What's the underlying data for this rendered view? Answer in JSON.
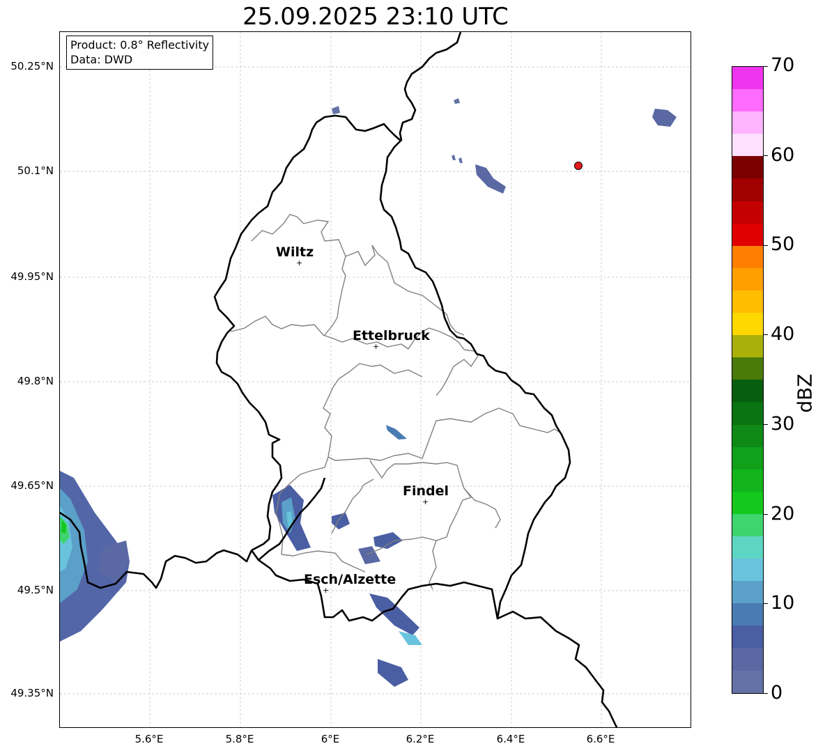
{
  "title": "25.09.2025 23:10 UTC",
  "info": {
    "product": "Product: 0.8° Reflectivity",
    "data": "Data: DWD"
  },
  "lat_ticks": [
    "50.25°N",
    "50.1°N",
    "49.95°N",
    "49.8°N",
    "49.65°N",
    "49.5°N",
    "49.35°N"
  ],
  "lon_ticks": [
    "5.6°E",
    "5.8°E",
    "6°E",
    "6.2°E",
    "6.4°E",
    "6.6°E"
  ],
  "cities": [
    {
      "name": "Wiltz"
    },
    {
      "name": "Ettelbruck"
    },
    {
      "name": "Findel"
    },
    {
      "name": "Esch/Alzette"
    }
  ],
  "city_marker_glyph": "+",
  "colorbar": {
    "label": "dBZ",
    "ticks": [
      "0",
      "10",
      "20",
      "30",
      "40",
      "50",
      "60",
      "70"
    ],
    "colors": [
      "#6472a8",
      "#5a68a4",
      "#4a5ea3",
      "#4a7cb4",
      "#5ba0c8",
      "#6ac3dc",
      "#5ed6c4",
      "#3ed46e",
      "#14c81e",
      "#12b41c",
      "#11a01a",
      "#0f8a16",
      "#0b7412",
      "#075e0e",
      "#4a7a0a",
      "#aab00a",
      "#ffd800",
      "#ffbe00",
      "#ffa000",
      "#ff8000",
      "#e10000",
      "#c40000",
      "#a00000",
      "#7a0000",
      "#ffe0ff",
      "#ffb4ff",
      "#ff6cff",
      "#ee34ee"
    ]
  },
  "radar_site_color": "#e21a1a",
  "border_colors": {
    "national": "#000000",
    "canton": "#808080"
  }
}
